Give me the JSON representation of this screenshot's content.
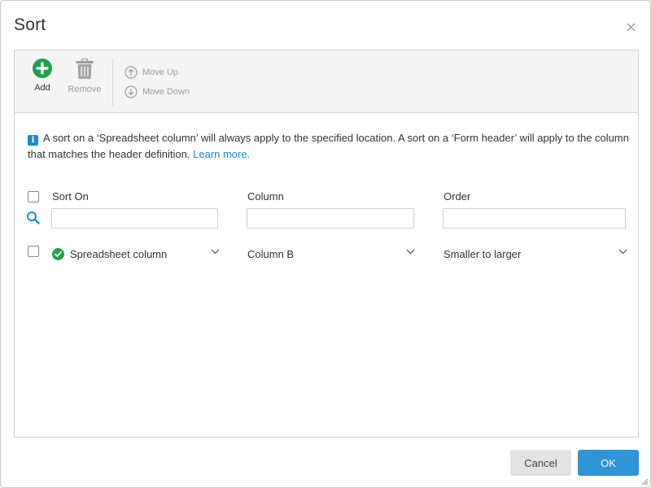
{
  "dialog": {
    "title": "Sort",
    "close_icon": "close-icon"
  },
  "toolbar": {
    "add_label": "Add",
    "add_icon": "plus-circle-icon",
    "remove_label": "Remove",
    "remove_icon": "trash-icon",
    "move_up_label": "Move Up",
    "move_up_icon": "arrow-up-circle-icon",
    "move_down_label": "Move Down",
    "move_down_icon": "arrow-down-circle-icon"
  },
  "info": {
    "text": "A sort on a ‘Spreadsheet column’ will always apply to the specified location. A sort on a ‘Form header’ will apply to the column that matches the header definition.",
    "link_text": "Learn more.",
    "icon": "info-icon"
  },
  "table": {
    "headers": {
      "sort_on": "Sort On",
      "column": "Column",
      "order": "Order"
    },
    "filters": {
      "sort_on": "",
      "column": "",
      "order": ""
    },
    "rows": [
      {
        "checked": false,
        "status_icon": "check-circle-icon",
        "sort_on": "Spreadsheet column",
        "column": "Column B",
        "order": "Smaller to larger"
      }
    ]
  },
  "footer": {
    "cancel_label": "Cancel",
    "ok_label": "OK"
  },
  "colors": {
    "accent": "#2e95d6",
    "success": "#25a24a",
    "add_green": "#1fa04b",
    "link": "#1b8ad0"
  }
}
